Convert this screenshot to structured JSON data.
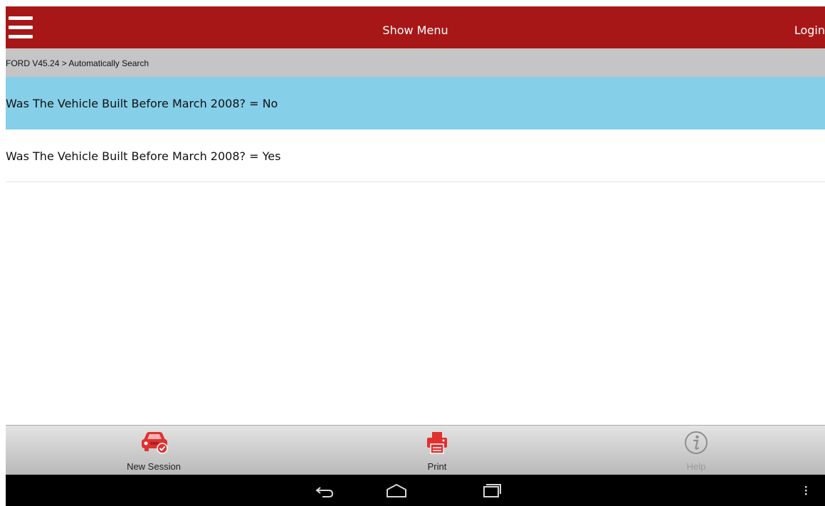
{
  "header": {
    "title": "Show Menu",
    "login_label": "Login",
    "menu_icon": "hamburger-menu-icon",
    "bg_color": "#a81717"
  },
  "breadcrumb": {
    "text": "FORD V45.24 > Automatically Search"
  },
  "list": {
    "items": [
      {
        "label": "Was The Vehicle Built Before March 2008? = No",
        "selected": true
      },
      {
        "label": "Was The Vehicle Built Before March 2008? = Yes",
        "selected": false
      }
    ],
    "selected_color": "#86cfe9"
  },
  "toolbar": {
    "new_session_label": "New Session",
    "new_session_icon": "car-check-icon",
    "print_label": "Print",
    "print_icon": "printer-icon",
    "help_label": "Help",
    "help_icon": "info-icon",
    "accent_color": "#e03030"
  },
  "system_nav": {
    "back_icon": "back-icon",
    "home_icon": "home-icon",
    "recents_icon": "recents-icon",
    "overflow_icon": "overflow-menu-icon"
  }
}
